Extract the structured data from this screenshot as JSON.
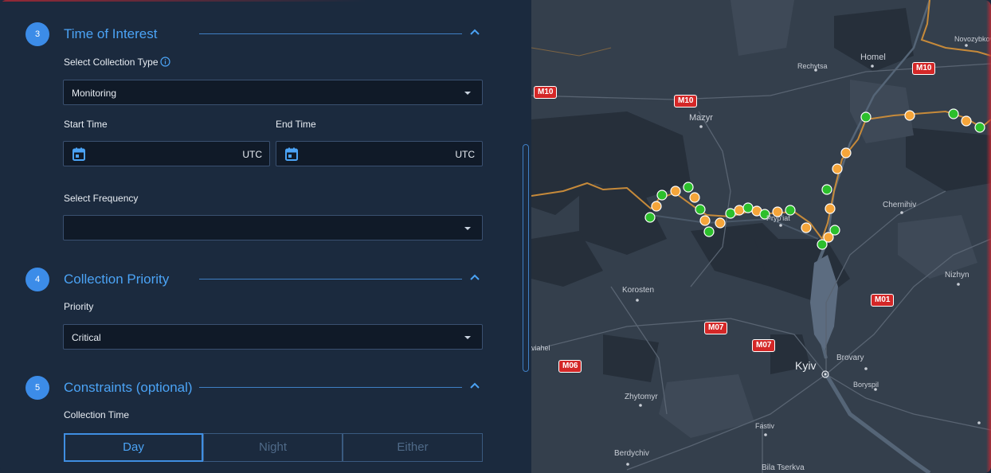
{
  "sections": {
    "time_of_interest": {
      "step": "3",
      "title": "Time of Interest"
    },
    "collection_priority": {
      "step": "4",
      "title": "Collection Priority"
    },
    "constraints": {
      "step": "5",
      "title": "Constraints (optional)"
    }
  },
  "collection_type": {
    "label": "Select Collection Type",
    "value": "Monitoring"
  },
  "start_time": {
    "label": "Start Time",
    "suffix": "UTC"
  },
  "end_time": {
    "label": "End Time",
    "suffix": "UTC"
  },
  "frequency": {
    "label": "Select Frequency",
    "value": ""
  },
  "priority": {
    "label": "Priority",
    "value": "Critical"
  },
  "collection_time": {
    "label": "Collection Time",
    "options": [
      "Day",
      "Night",
      "Either"
    ],
    "selected": "Day"
  },
  "map": {
    "places": [
      "Novozybkov",
      "Rechytsa",
      "Homel",
      "Mazyr",
      "Pryp'iat",
      "Chernihiv",
      "Korosten",
      "Nizhyn",
      "Kyiv",
      "Brovary",
      "Boryspil",
      "Zhytomyr",
      "Fastiv",
      "Berdychiv",
      "Bila Tserkva",
      "viahel"
    ],
    "roads": [
      "M10",
      "M10",
      "M10",
      "M07",
      "M07",
      "M01",
      "M06"
    ]
  }
}
